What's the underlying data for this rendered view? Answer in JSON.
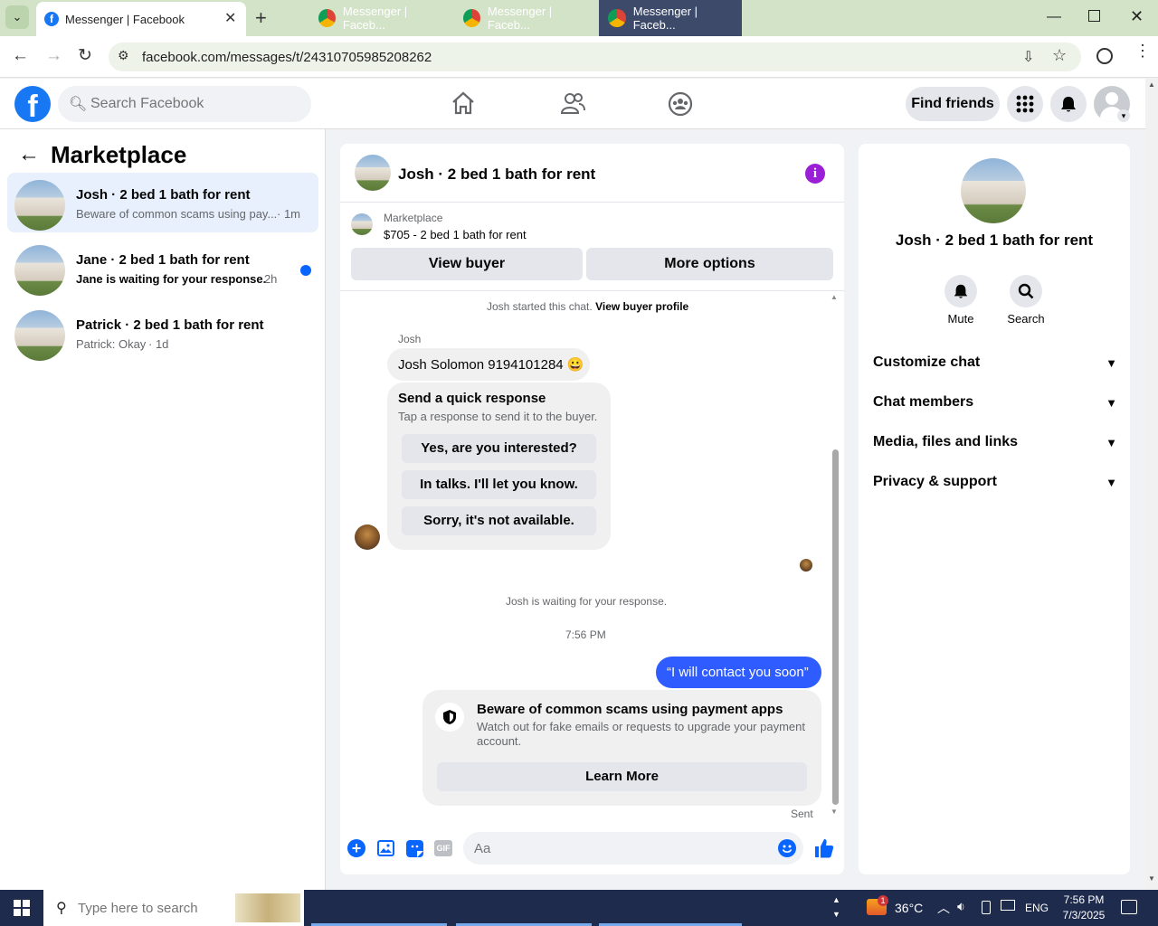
{
  "browser": {
    "tab_title": "Messenger | Facebook",
    "url": "facebook.com/messages/t/24310705985208262"
  },
  "fb": {
    "search_placeholder": "Search Facebook",
    "find_friends": "Find friends"
  },
  "left": {
    "title": "Marketplace",
    "conversations": [
      {
        "name": "Josh · 2 bed 1 bath for rent",
        "preview": "Beware of common scams using pay...",
        "time": "· 1m"
      },
      {
        "name": "Jane · 2 bed 1 bath for rent",
        "preview": "Jane is waiting for your response.",
        "time": "· 2h"
      },
      {
        "name": "Patrick · 2 bed 1 bath for rent",
        "preview": "Patrick: Okay",
        "time": "· 1d"
      }
    ]
  },
  "chat": {
    "header_title": "Josh · 2 bed 1 bath for rent",
    "listing_source": "Marketplace",
    "listing_line": "$705 - 2 bed 1 bath for rent",
    "view_buyer": "View buyer",
    "more_options": "More options",
    "started_text": "Josh started this chat.",
    "view_buyer_profile": "View buyer profile",
    "sender_name": "Josh",
    "incoming_message": "Josh Solomon 9194101284 😀",
    "quick_title": "Send a quick response",
    "quick_subtitle": "Tap a response to send it to the buyer.",
    "quick_responses": [
      "Yes, are you interested?",
      "In talks. I'll let you know.",
      "Sorry, it's not available."
    ],
    "waiting_text": "Josh is waiting for your response.",
    "timestamp": "7:56 PM",
    "outgoing_message": "“I will contact you soon”",
    "scam_title": "Beware of common scams using payment apps",
    "scam_body": "Watch out for fake emails or requests to upgrade your payment account.",
    "learn_more": "Learn More",
    "sent_status": "Sent",
    "composer_placeholder": "Aa"
  },
  "right": {
    "title": "Josh · 2 bed 1 bath for rent",
    "mute_label": "Mute",
    "search_label": "Search",
    "sections": [
      "Customize chat",
      "Chat members",
      "Media, files and links",
      "Privacy & support"
    ]
  },
  "taskbar": {
    "search_placeholder": "Type here to search",
    "apps": [
      "Messenger | Faceb...",
      "Messenger | Faceb...",
      "Messenger | Faceb..."
    ],
    "weather": "36°C",
    "language": "ENG",
    "notification_count": "1",
    "time": "7:56 PM",
    "date": "7/3/2025"
  },
  "colors": {
    "brand_blue": "#1877f2",
    "messenger_blue": "#2e5cff",
    "info_purple": "#9b1fd6",
    "taskbar": "#1e2b4d"
  }
}
